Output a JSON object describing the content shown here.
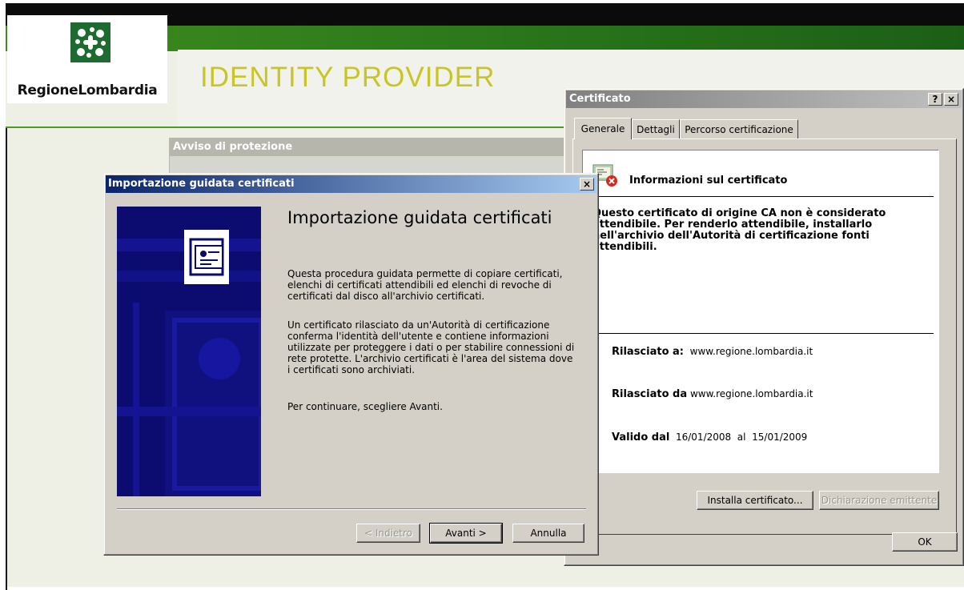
{
  "page": {
    "logo_text": "RegioneLombardia",
    "title": "IDENTITY PROVIDER",
    "notice_title": "Avviso di protezione"
  },
  "cert_window": {
    "title": "Certificato",
    "help_label": "?",
    "close_label": "×",
    "tabs": [
      {
        "label": "Generale"
      },
      {
        "label": "Dettagli"
      },
      {
        "label": "Percorso certificazione"
      }
    ],
    "info_title": "Informazioni sul certificato",
    "warning": "Questo certificato di origine CA non è considerato attendibile. Per renderlo attendibile, installarlo nell'archivio dell'Autorità di certificazione fonti attendibili.",
    "issued_to_label": "Rilasciato a:",
    "issued_to_value": "www.regione.lombardia.it",
    "issued_by_label": "Rilasciato da",
    "issued_by_value": "www.regione.lombardia.it",
    "valid_from_label": "Valido dal",
    "valid_from_value": "16/01/2008",
    "valid_to_label": "al",
    "valid_to_value": "15/01/2009",
    "install_button": "Installa certificato...",
    "issuer_statement_button": "Dichiarazione emittente",
    "ok_button": "OK"
  },
  "wizard": {
    "title": "Importazione guidata certificati",
    "close_label": "×",
    "heading": "Importazione guidata certificati",
    "para1": "Questa procedura guidata permette di copiare certificati, elenchi di certificati attendibili ed elenchi di revoche di certificati dal disco all'archivio certificati.",
    "para2": "Un certificato rilasciato da un'Autorità di certificazione conferma l'identità dell'utente e contiene informazioni utilizzate per proteggere i dati o per stabilire connessioni di rete protette. L'archivio certificati è l'area del sistema dove i certificati sono archiviati.",
    "para3": "Per continuare, scegliere Avanti.",
    "back_button": "< Indietro",
    "next_button": "Avanti >",
    "cancel_button": "Annulla"
  },
  "colors": {
    "brand_green": "#1e6b31",
    "title_yellow": "#c8c626",
    "active_titlebar": "#0a246a",
    "inactive_titlebar": "#808080"
  }
}
